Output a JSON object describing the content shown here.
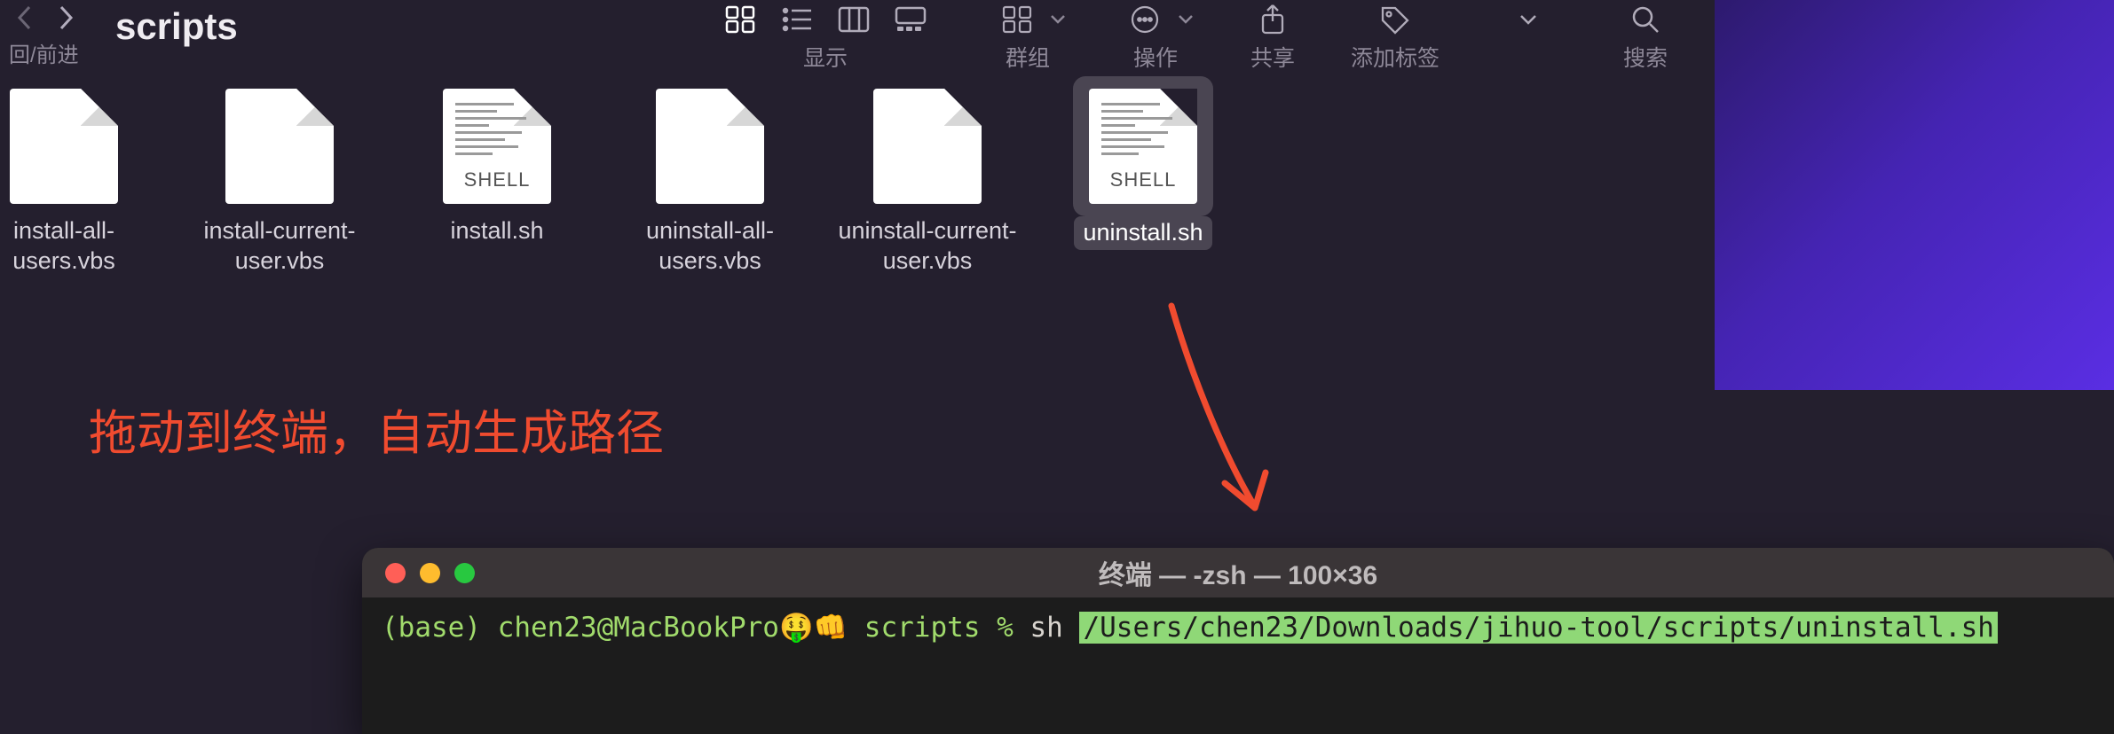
{
  "right_strip": {},
  "finder": {
    "nav_label": "回/前进",
    "title": "scripts",
    "toolbar": {
      "view_label": "显示",
      "group_label": "群组",
      "action_label": "操作",
      "share_label": "共享",
      "tags_label": "添加标签",
      "search_label": "搜索"
    },
    "files": [
      {
        "name": "install-all-\nusers.vbs",
        "type": "plain",
        "selected": false
      },
      {
        "name": "install-current-\nuser.vbs",
        "type": "plain",
        "selected": false
      },
      {
        "name": "install.sh",
        "type": "shell",
        "selected": false
      },
      {
        "name": "uninstall-all-\nusers.vbs",
        "type": "plain",
        "selected": false
      },
      {
        "name": "uninstall-current-\nuser.vbs",
        "type": "plain",
        "selected": false
      },
      {
        "name": "uninstall.sh",
        "type": "shell",
        "selected": true
      }
    ],
    "shell_tag": "SHELL",
    "annotation": "拖动到终端，自动生成路径"
  },
  "terminal": {
    "title": "终端 — -zsh — 100×36",
    "traffic_colors": {
      "close": "#ff5f57",
      "min": "#febc2e",
      "max": "#28c840"
    },
    "prompt": {
      "base": "(base) ",
      "user_host": "chen23@MacBookPro",
      "emoji": "🤑👊",
      "dir": " scripts ",
      "pct": "% ",
      "cmd": "sh ",
      "selected_path": "/Users/chen23/Downloads/jihuo-tool/scripts/uninstall.sh"
    }
  },
  "colors": {
    "annotation": "#f04b2f"
  }
}
